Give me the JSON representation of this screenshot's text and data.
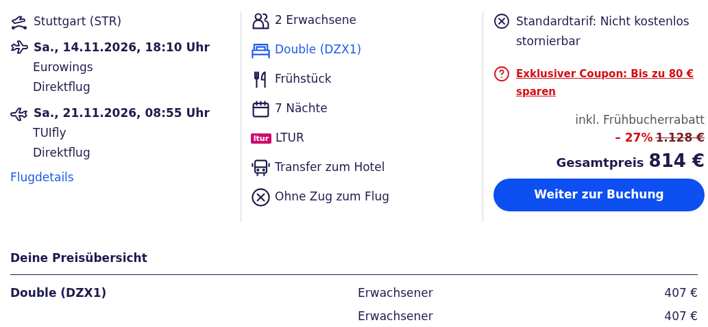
{
  "flights": {
    "departure_airport": "Stuttgart (STR)",
    "legs": [
      {
        "kind": "outbound",
        "date": "Sa., 14.11.2026, 18:10 Uhr",
        "airline": "Eurowings",
        "type": "Direktflug"
      },
      {
        "kind": "return",
        "date": "Sa., 21.11.2026, 08:55 Uhr",
        "airline": "TUIfly",
        "type": "Direktflug"
      }
    ],
    "details_link": "Flugdetails"
  },
  "features": [
    {
      "kind": "persons",
      "label": "2 Erwachsene",
      "link": false
    },
    {
      "kind": "bed",
      "label": "Double (DZX1)",
      "link": true
    },
    {
      "kind": "cutlery",
      "label": "Frühstück",
      "link": false
    },
    {
      "kind": "calendar",
      "label": "7 Nächte",
      "link": false
    },
    {
      "kind": "brand",
      "logo_text": "ltur",
      "label": "LTUR",
      "link": false
    },
    {
      "kind": "bus",
      "label": "Transfer zum Hotel",
      "link": false
    },
    {
      "kind": "cross",
      "label": "Ohne Zug zum Flug",
      "link": false
    }
  ],
  "price_box": {
    "tariff": "Standardtarif: Nicht kostenlos stornierbar",
    "coupon": "Exklusiver Coupon: Bis zu 80 € sparen",
    "discount_note": "inkl. Frühbucherrabatt",
    "discount": "– 27%",
    "old_price": "1.128 €",
    "total_label": "Gesamtpreis",
    "total": "814 €",
    "button": "Weiter zur Buchung"
  },
  "price_overview": {
    "title": "Deine Preisübersicht",
    "rows": [
      {
        "item": "Double (DZX1)",
        "traveler": "Erwachsener",
        "price": "407 €"
      },
      {
        "traveler": "Erwachsener",
        "price": "407 €"
      }
    ]
  }
}
